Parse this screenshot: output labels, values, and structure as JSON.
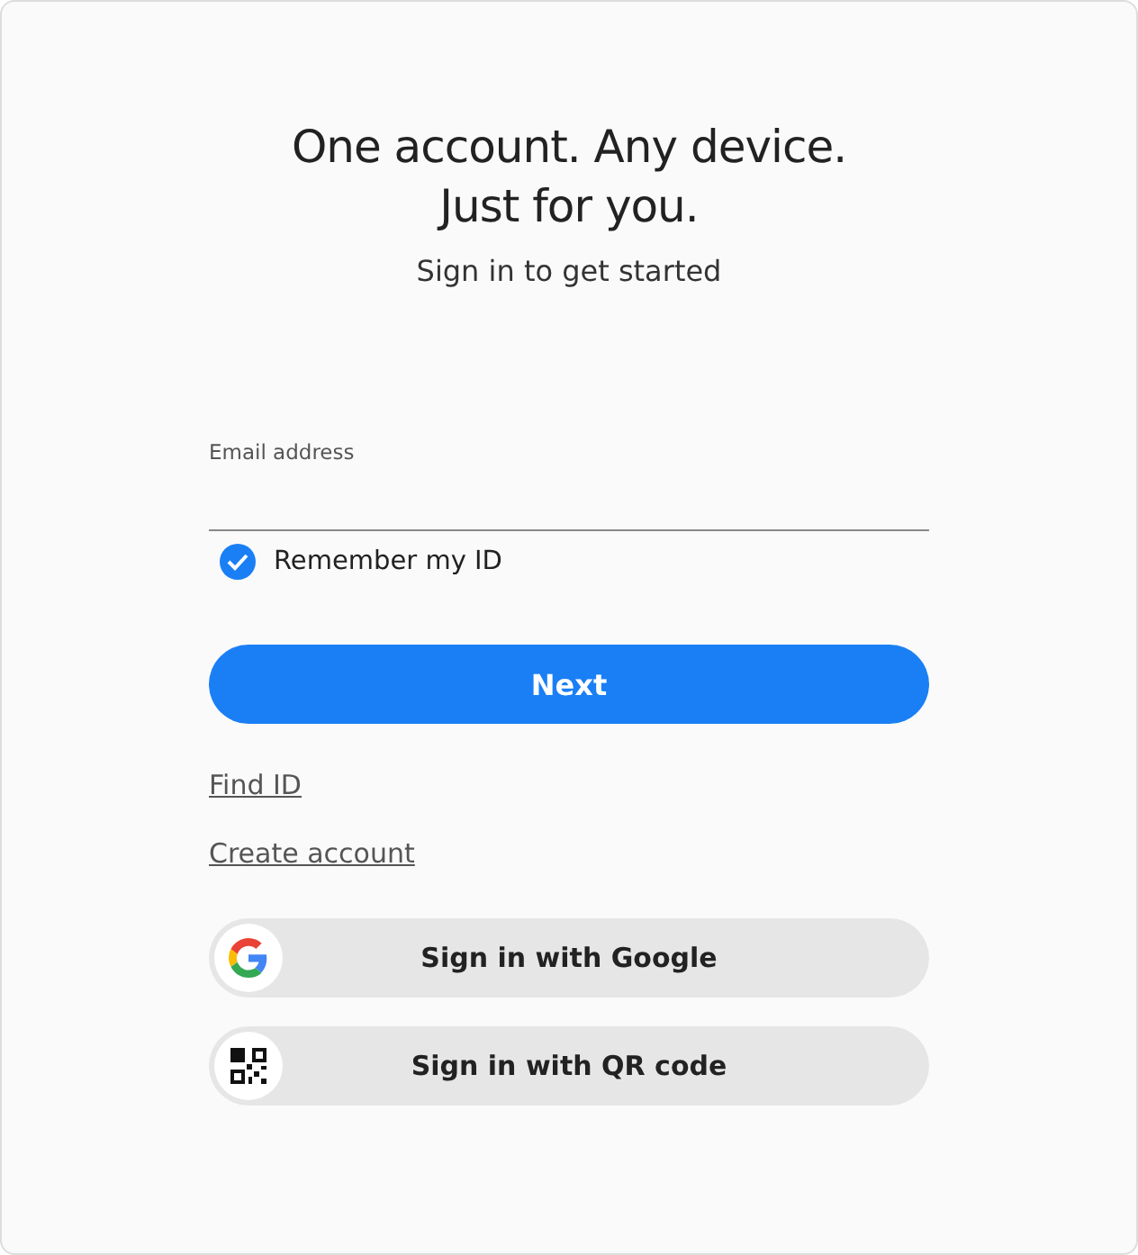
{
  "heading": [
    "One account. Any device.",
    "Just for you."
  ],
  "subtitle": "Sign in to get started",
  "email": {
    "label": "Email address"
  },
  "remember": {
    "label": "Remember my ID",
    "checked": true
  },
  "next_button": "Next",
  "links": [
    "Find ID",
    "Create account"
  ],
  "social_buttons": [
    {
      "kind": "google",
      "label": "Sign in with Google"
    },
    {
      "kind": "qr",
      "label": "Sign in with QR code"
    }
  ]
}
